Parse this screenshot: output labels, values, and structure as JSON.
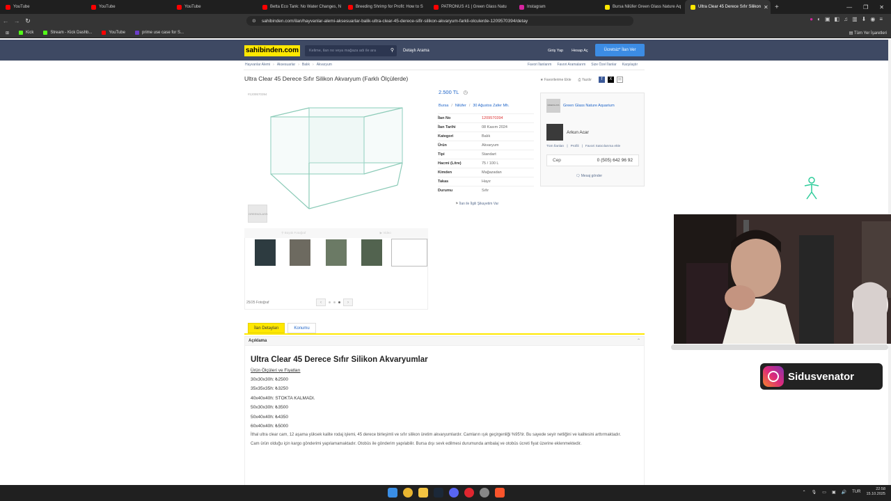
{
  "browser": {
    "tabs": [
      {
        "label": "YouTube",
        "color": "#ff0000"
      },
      {
        "label": "YouTube",
        "color": "#ff0000"
      },
      {
        "label": "YouTube",
        "color": "#ff0000"
      },
      {
        "label": "Betta Eco Tank: No Water Changes, N",
        "color": "#ff0000"
      },
      {
        "label": "Breeding Shrimp for Profit: How to S",
        "color": "#ff0000"
      },
      {
        "label": "PATRONUS #1 | Green Glass Natu",
        "color": "#ff0000"
      },
      {
        "label": "Instagram",
        "color": "#d6249f"
      },
      {
        "label": "Bursa Nilüfer Green Glass Nature Aq",
        "color": "#ffe800"
      },
      {
        "label": "Ultra Clear 45 Derece Sıfır Silikon",
        "color": "#ffe800"
      }
    ],
    "active_tab_index": 8,
    "url": "sahibinden.com/ilan/hayvanlar-alemi-aksesuarlar-balik-ultra-clear-45-derece-sifir-silikon-akvaryum-farkli-olculerde-1209570394/detay",
    "bookmarks": [
      {
        "label": "Kick",
        "color": "#53fc18"
      },
      {
        "label": "Stream - Kick Dashb...",
        "color": "#53fc18"
      },
      {
        "label": "YouTube",
        "color": "#ff0000"
      },
      {
        "label": "prime use case for S...",
        "color": "#6a3dc9"
      }
    ],
    "all_bookmarks": "Tüm Yer İşaretleri"
  },
  "site": {
    "logo": "sahibinden.com",
    "search_placeholder": "Kelime, ilan no veya mağaza adı ile ara",
    "advanced_search": "Detaylı Arama",
    "login": "Giriş Yap",
    "register": "Hesap Aç",
    "post_ad": "Ücretsiz* İlan Ver",
    "breadcrumb": [
      "Hayvanlar Alemi",
      "Aksesuarlar",
      "Balık",
      "Akvaryum"
    ],
    "top_links": [
      "Favori İlanlarım",
      "Favori Aramalarım",
      "Size Özel İlanlar",
      "Karşılaştır"
    ]
  },
  "listing": {
    "title": "Ultra Clear 45 Derece Sıfır Silikon Akvaryum (Farklı Ölçülerde)",
    "add_favorite": "Favorilerime Ekle",
    "print": "Yazdır",
    "small_id": "#1209570394",
    "small_thumb_label": "GREENGLASS",
    "zoom_label": "Büyük Fotoğraf",
    "video_label": "Video",
    "photo_count": "25/25 Fotoğraf",
    "price": "2.500 TL",
    "location": [
      "Bursa",
      "Nilüfer",
      "30 Ağustos Zafer Mh."
    ],
    "props": [
      {
        "k": "İlan No",
        "v": "1209570394"
      },
      {
        "k": "İlan Tarihi",
        "v": "08 Kasım 2024"
      },
      {
        "k": "Kategori",
        "v": "Balık"
      },
      {
        "k": "Ürün",
        "v": "Akvaryum"
      },
      {
        "k": "Tipi",
        "v": "Standart"
      },
      {
        "k": "Hacmi (Litre)",
        "v": "75 / 100 L"
      },
      {
        "k": "Kimden",
        "v": "Mağazadan"
      },
      {
        "k": "Takas",
        "v": "Hayır"
      },
      {
        "k": "Durumu",
        "v": "Sıfır"
      }
    ],
    "complaint": "İlan ile İlgili Şikayetim Var"
  },
  "seller": {
    "store": "Green Glass Nature Aquarium",
    "store_logo_text": "GREENGLASS",
    "person": "Arkun Acar",
    "links": [
      "Tüm İlanları",
      "Profili",
      "Favori Satıcılarıma ekle"
    ],
    "phone_label": "Cep",
    "phone": "0 (505) 642 96 92",
    "message": "Mesaj gönder"
  },
  "detail_tabs": [
    "İlan Detayları",
    "Konumu"
  ],
  "description": {
    "header": "Açıklama",
    "heading": "Ultra Clear 45 Derece Sıfır Silikon Akvaryumlar",
    "subheading": "Ürün Ölçüleri ve Fiyatları",
    "sizes": [
      "30x30x30h: ₺2500",
      "35x35x35h: ₺3250",
      "40x40x40h: STOKTA KALMADI.",
      "50x30x30h: ₺3500",
      "50x40x40h: ₺4350",
      "60x40x40h: ₺5000"
    ],
    "para1": "İthal ultra clear cam, 12 aşama yüksek kalite rodaj işlemi, 45 derece birleşimli ve sıfır silikon üretim akvaryumlardır. Camların ışık geçirgenliği %95'tir. Bu sayede seyir netliğini ve kalitesini arttırmaktadır.",
    "para2": "Cam ürün olduğu için kargo gönderimi yapılamamaktadır. Otobüs ile gönderim yapılabilir. Bursa dışı sevk edilmesi durumunda ambalaj ve otobüs ücreti fiyat üzerine eklenmektedir."
  },
  "overlay": {
    "instagram_name": "Sidusvenator"
  },
  "taskbar": {
    "lang": "TUR",
    "time": "22:58",
    "date": "15.10.2025"
  }
}
